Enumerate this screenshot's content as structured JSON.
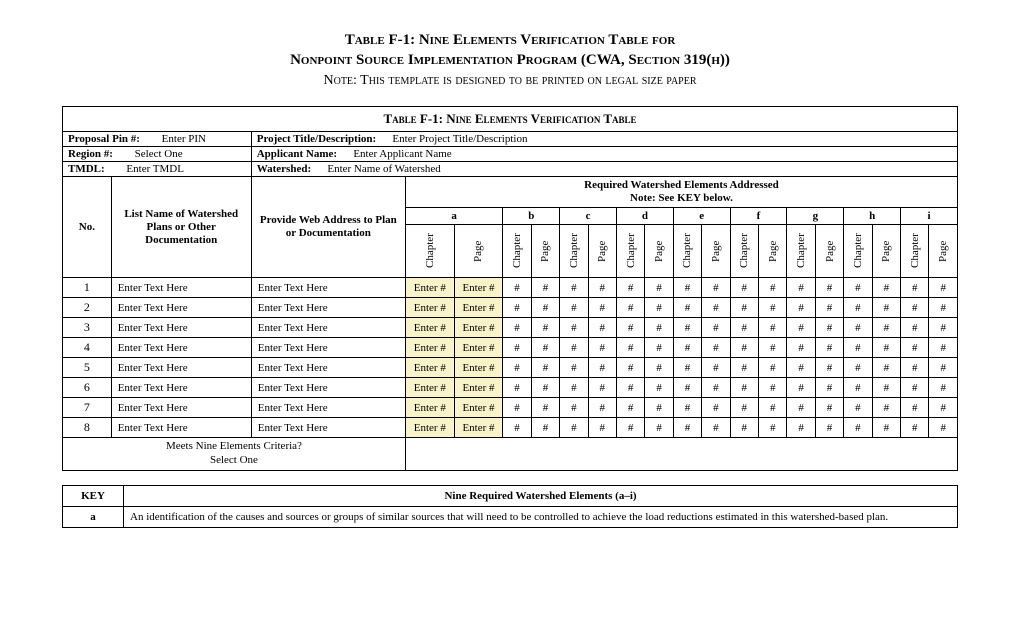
{
  "title": {
    "line1": "Table F-1: Nine Elements Verification Table for",
    "line2": "Nonpoint Source Implementation Program (CWA, Section 319(h))",
    "note": "Note: This template is designed to be printed on legal size paper"
  },
  "caption": "Table F-1: Nine Elements Verification Table",
  "info": {
    "proposal_label": "Proposal Pin #:",
    "proposal_value": "Enter PIN",
    "project_label": "Project Title/Description:",
    "project_value": "Enter Project Title/Description",
    "region_label": "Region #:",
    "region_value": "Select One",
    "applicant_label": "Applicant Name:",
    "applicant_value": "Enter Applicant Name",
    "tmdl_label": "TMDL:",
    "tmdl_value": "Enter TMDL",
    "watershed_label": "Watershed:",
    "watershed_value": "Enter Name of Watershed"
  },
  "req_header_line1": "Required Watershed Elements Addressed",
  "req_header_line2": "Note: See KEY below.",
  "letters": [
    "a",
    "b",
    "c",
    "d",
    "e",
    "f",
    "g",
    "h",
    "i"
  ],
  "col_no": "No.",
  "col_name": "List Name of Watershed Plans or Other Documentation",
  "col_web": "Provide Web Address to Plan or Documentation",
  "sub_chapter": "Chapter",
  "sub_page": "Page",
  "enter_num": "Enter #",
  "hash": "#",
  "rows": [
    {
      "n": "1",
      "name": "Enter Text Here",
      "web": "Enter Text Here"
    },
    {
      "n": "2",
      "name": "Enter Text Here",
      "web": "Enter Text Here"
    },
    {
      "n": "3",
      "name": "Enter Text Here",
      "web": "Enter Text Here"
    },
    {
      "n": "4",
      "name": "Enter Text Here",
      "web": "Enter Text Here"
    },
    {
      "n": "5",
      "name": "Enter Text Here",
      "web": "Enter Text Here"
    },
    {
      "n": "6",
      "name": "Enter Text Here",
      "web": "Enter Text Here"
    },
    {
      "n": "7",
      "name": "Enter Text Here",
      "web": "Enter Text Here"
    },
    {
      "n": "8",
      "name": "Enter Text Here",
      "web": "Enter Text Here"
    }
  ],
  "meets_line1": "Meets Nine Elements Criteria?",
  "meets_line2": "Select One",
  "key": {
    "label": "KEY",
    "header": "Nine Required Watershed Elements (a–i)",
    "a_letter": "a",
    "a_text": "An identification of the causes and sources or groups of similar sources that will need to be controlled to achieve the load reductions estimated in this watershed-based plan."
  }
}
